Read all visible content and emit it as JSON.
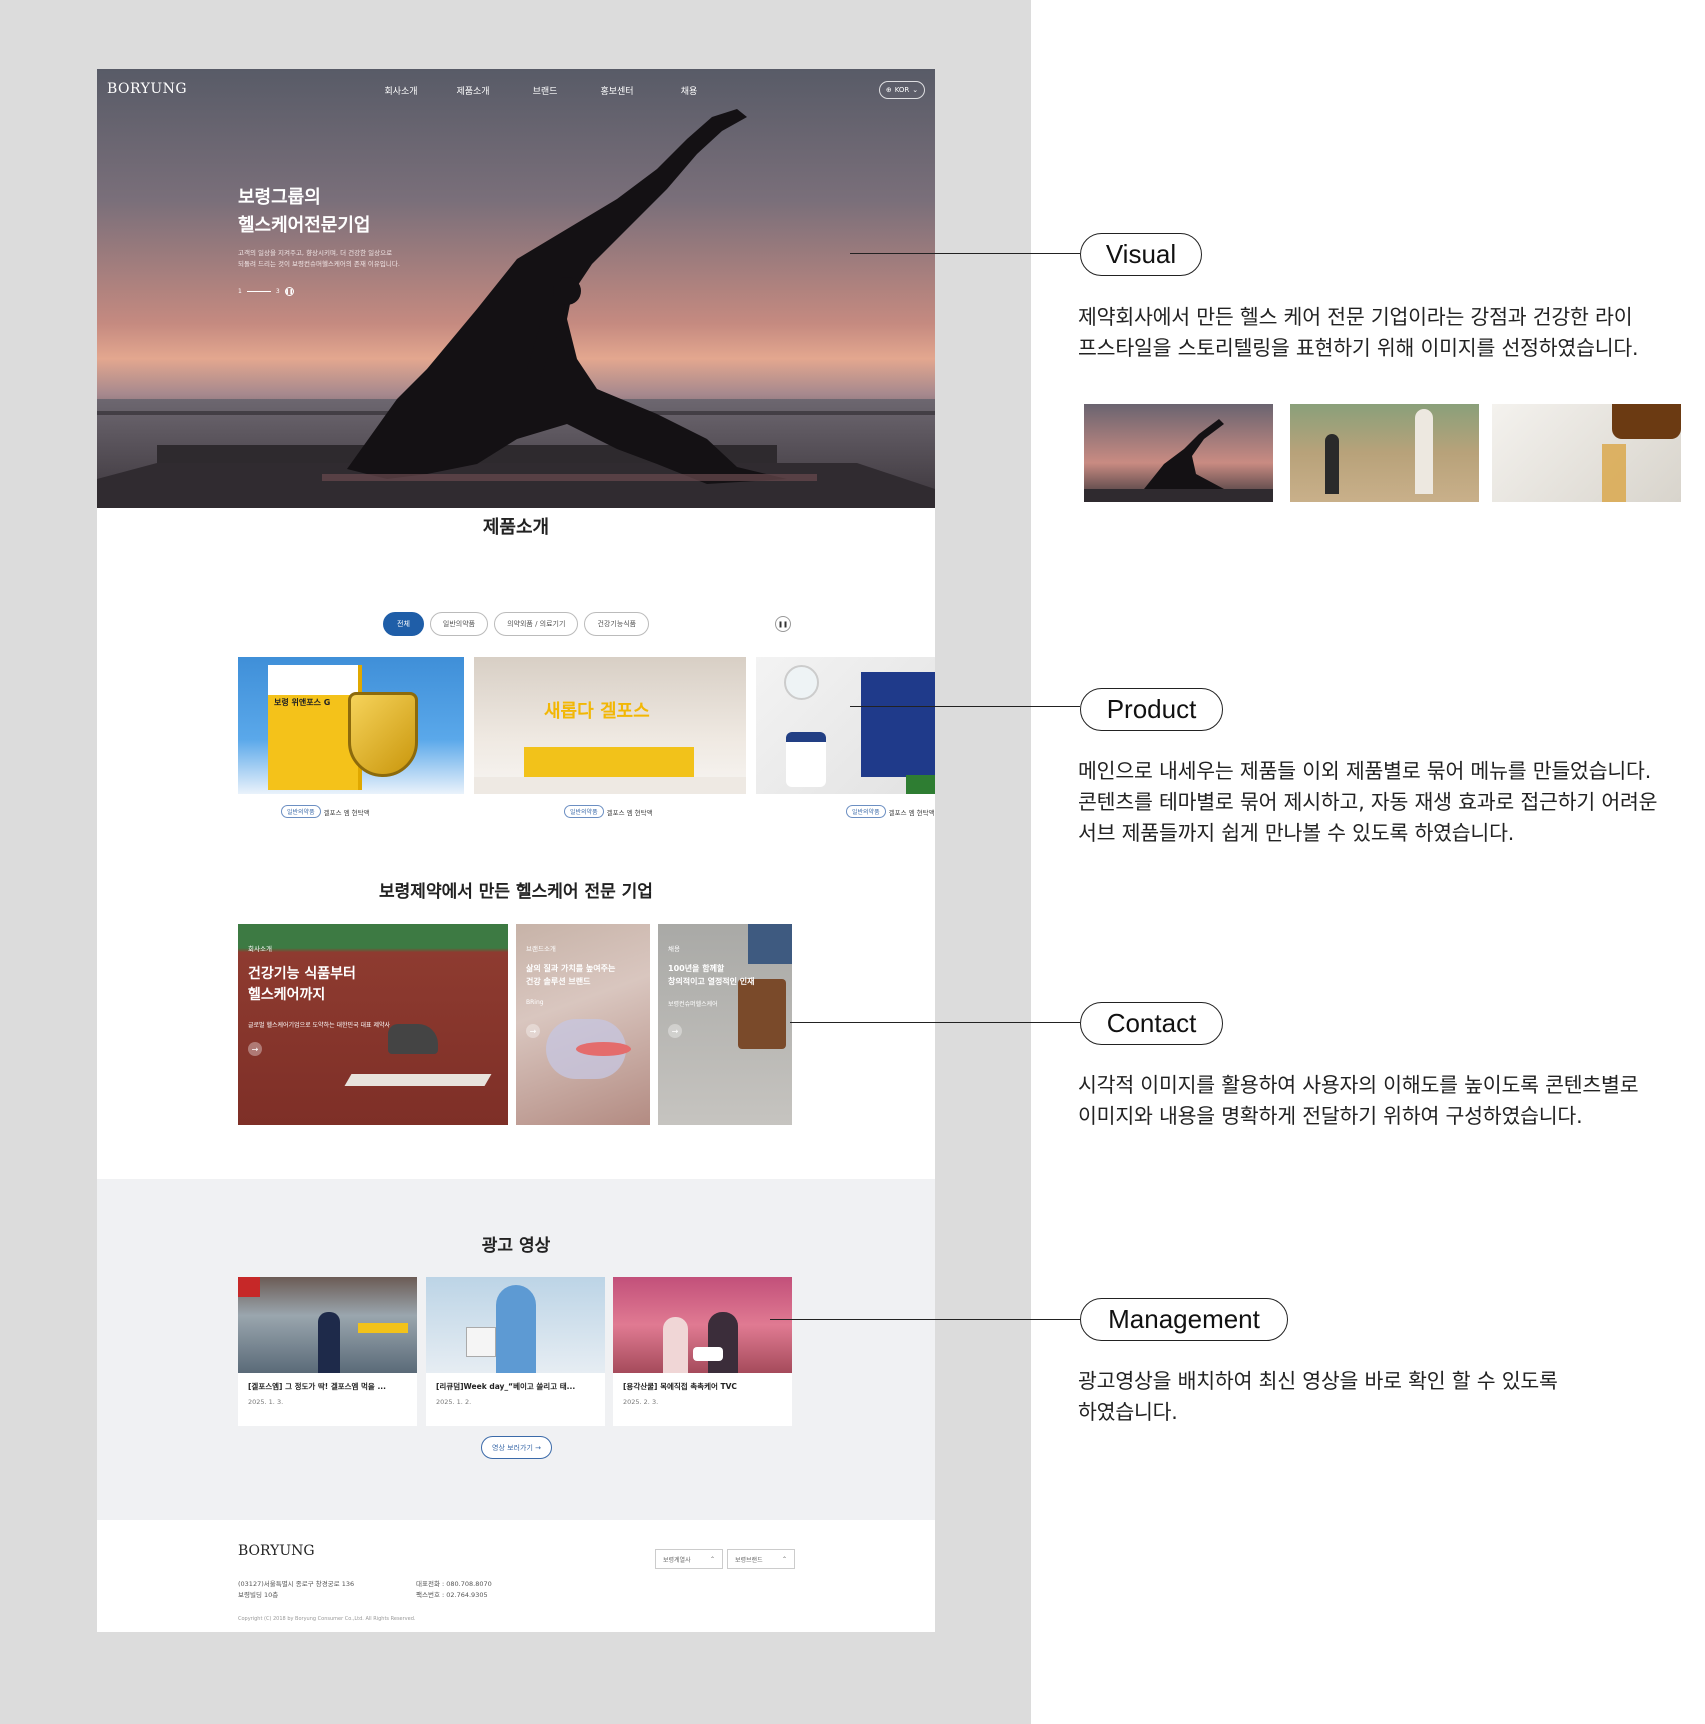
{
  "site": {
    "logo": "BORYUNG",
    "nav": [
      "회사소개",
      "제품소개",
      "브랜드",
      "홍보센터",
      "채용"
    ],
    "lang": "KOR"
  },
  "hero": {
    "title_line1": "보령그룹의",
    "title_line2": "헬스케어전문기업",
    "desc_line1": "고객의 일상을 지켜주고, 향상시키며, 더 건강한 일상으로",
    "desc_line2": "되돌려 드리는 것이 보령컨슈머헬스케어의 존재 이유입니다.",
    "pager_current": "1",
    "pager_total": "3"
  },
  "products": {
    "title": "제품소개",
    "tabs": [
      "전체",
      "일반의약품",
      "의약외품 / 의료기기",
      "건강기능식품"
    ],
    "cards": [
      {
        "badge": "일반의약품",
        "name": "겔포스 엠 현탁액",
        "label": "보령 위앤포스 G"
      },
      {
        "badge": "일반의약품",
        "name": "겔포스 엠 현탁액",
        "label": "새롭다 겔포스"
      },
      {
        "badge": "일반의약품",
        "name": "겔포스 엠 현탁액"
      }
    ]
  },
  "company": {
    "title": "보령제약에서 만든 헬스케어 전문 기업",
    "cards": [
      {
        "category": "회사소개",
        "title_line1": "건강기능 식품부터",
        "title_line2": "헬스케어까지",
        "desc": "글로벌 헬스케어기업으로 도약하는 대한민국 대표 제약사"
      },
      {
        "category": "브랜드소개",
        "title_line1": "삶의 질과 가치를 높여주는",
        "title_line2": "건강 솔루션 브랜드",
        "desc": "BRing"
      },
      {
        "category": "채용",
        "title_line1": "100년을 함께할",
        "title_line2": "창의적이고 열정적인 인재",
        "desc": "보령컨슈머헬스케어"
      }
    ]
  },
  "ads": {
    "title": "광고 영상",
    "videos": [
      {
        "title": "[겔포스엠] 그 정도가 딱! 겔포스엠 먹을 ...",
        "date": "2025. 1. 3."
      },
      {
        "title": "[리큐덤]Week day_“베이고 쓸리고 태...",
        "date": "2025. 1. 2."
      },
      {
        "title": "[용각산쿨] 목에직접 촉촉케어 TVC",
        "date": "2025. 2. 3."
      }
    ],
    "more": "영상 보러가기"
  },
  "footer": {
    "logo": "BORYUNG",
    "select1": "보령계열사",
    "select2": "보령브랜드",
    "address_line1": "(03127)서울특별시 종로구 창경궁로 136",
    "address_line2": "보령빌딩 10층",
    "tel_label": "대표전화",
    "tel": "080.708.8070",
    "fax_label": "팩스번호",
    "fax": "02.764.9305",
    "copyright": "Copyright (C) 2018 by Boryung Consumer Co.,Ltd. All Rights Reserved."
  },
  "annotations": [
    {
      "label": "Visual",
      "line1": "제약회사에서 만든 헬스 케어 전문 기업이라는 강점과 건강한 라이",
      "line2": "프스타일을 스토리텔링을 표현하기 위해 이미지를 선정하였습니다."
    },
    {
      "label": "Product",
      "line1": "메인으로 내세우는 제품들 이외 제품별로 묶어 메뉴를 만들었습니다.",
      "line2": "콘텐츠를 테마별로 묶어 제시하고, 자동 재생 효과로 접근하기 어려운",
      "line3": "서브 제품들까지 쉽게 만나볼 수 있도록 하였습니다."
    },
    {
      "label": "Contact",
      "line1": "시각적 이미지를 활용하여 사용자의 이해도를 높이도록 콘텐츠별로",
      "line2": "이미지와 내용을 명확하게 전달하기 위하여 구성하였습니다."
    },
    {
      "label": "Management",
      "line1": "광고영상을 배치하여 최신 영상을 바로 확인 할 수 있도록",
      "line2": "하였습니다."
    }
  ],
  "colors": {
    "accent": "#1f5ea8",
    "gray_bg": "#dcdcdc",
    "ads_bg": "#f0f1f3"
  }
}
